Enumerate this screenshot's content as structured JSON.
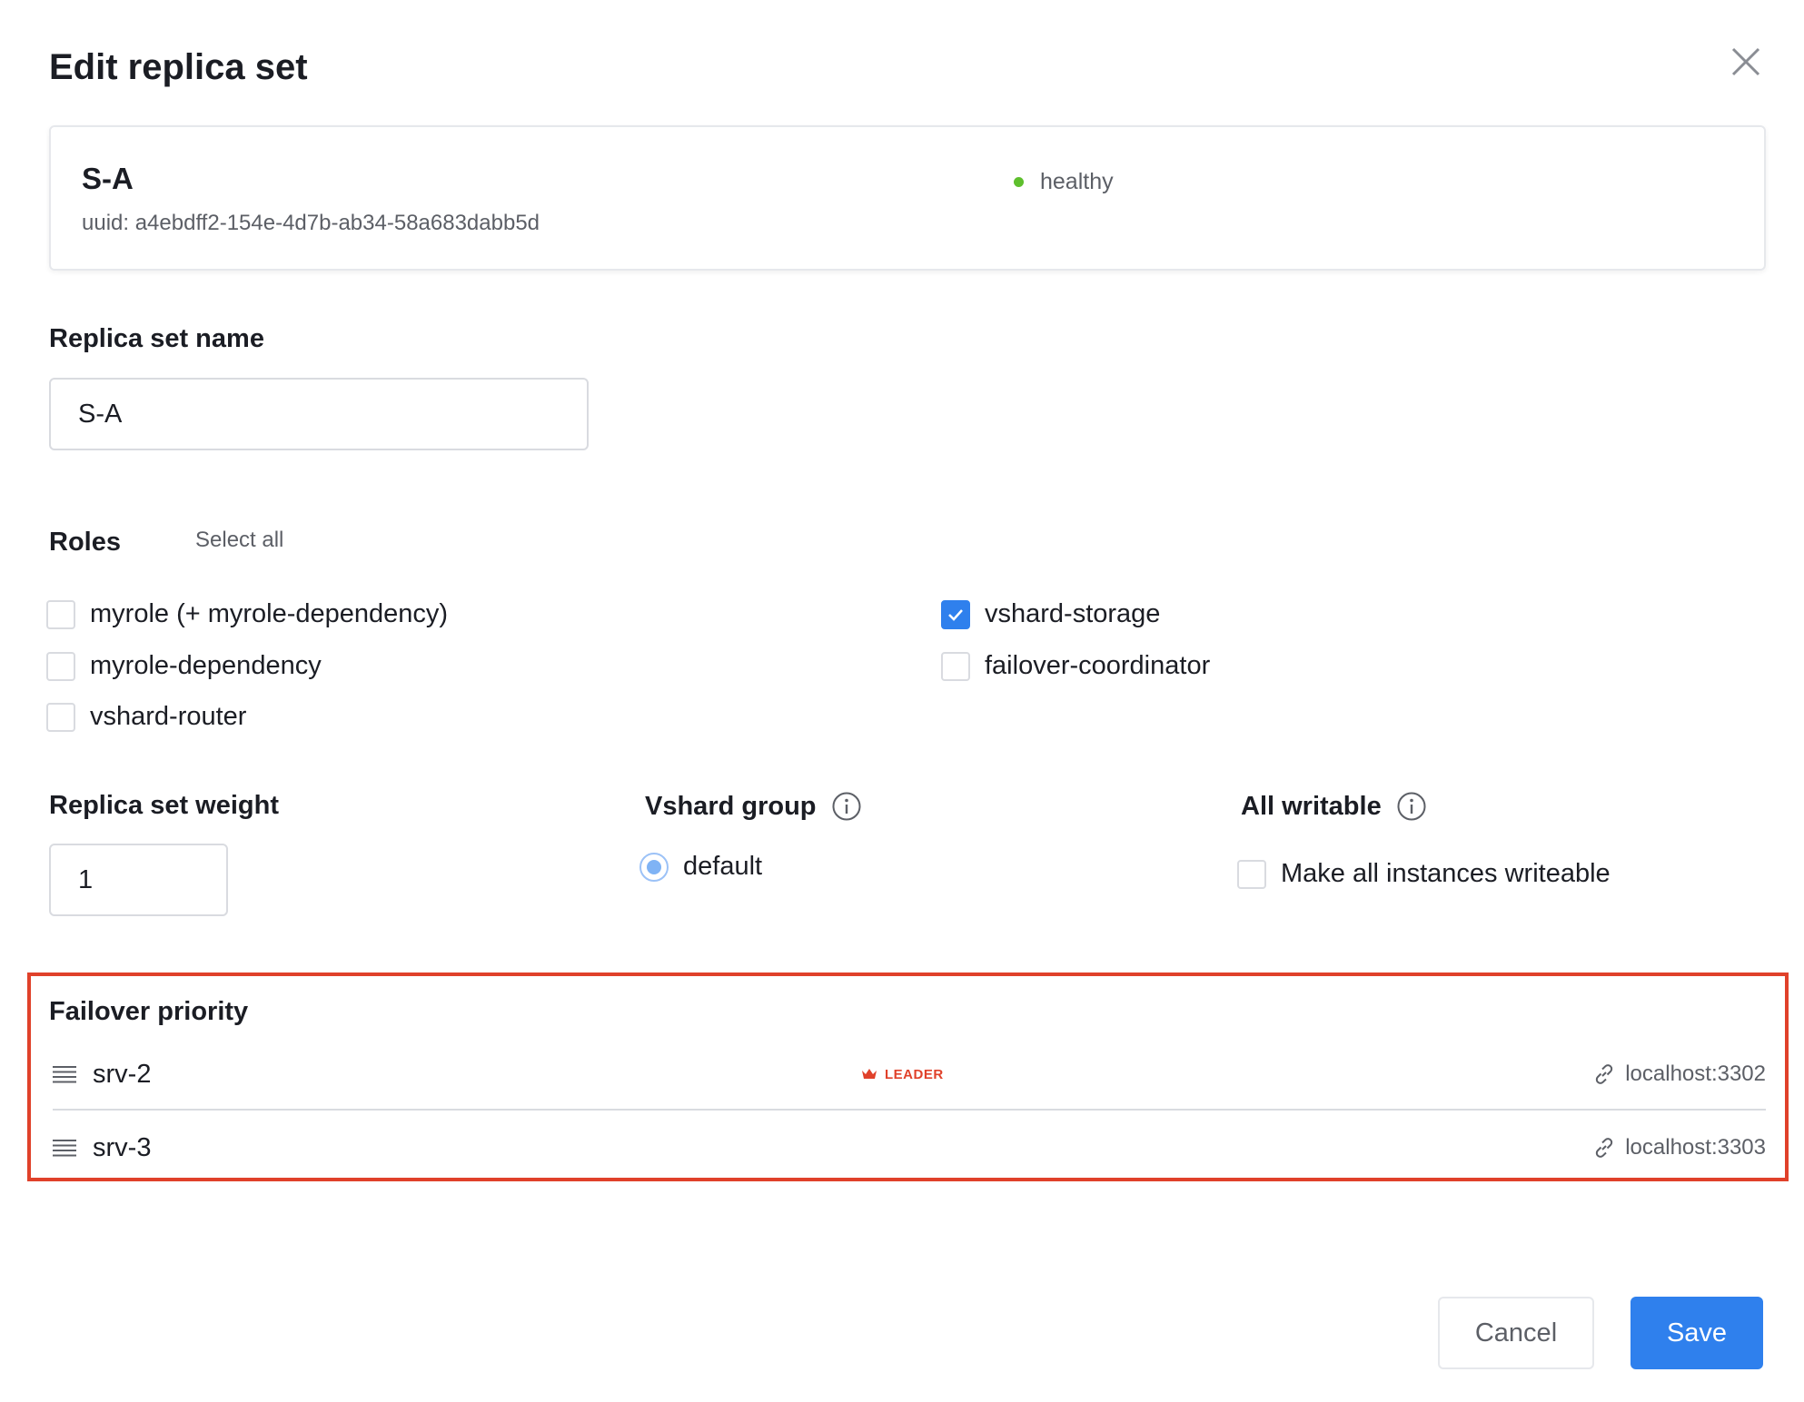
{
  "dialog": {
    "title": "Edit replica set"
  },
  "replicaset": {
    "name": "S-A",
    "uuid": "uuid: a4ebdff2-154e-4d7b-ab34-58a683dabb5d",
    "status": "healthy"
  },
  "name_field": {
    "label": "Replica set name",
    "value": "S-A"
  },
  "roles": {
    "label": "Roles",
    "select_all": "Select all",
    "items": [
      {
        "label": "myrole (+ myrole-dependency)",
        "checked": false
      },
      {
        "label": "myrole-dependency",
        "checked": false
      },
      {
        "label": "vshard-router",
        "checked": false
      },
      {
        "label": "vshard-storage",
        "checked": true
      },
      {
        "label": "failover-coordinator",
        "checked": false
      }
    ]
  },
  "weight": {
    "label": "Replica set weight",
    "value": "1"
  },
  "vshard_group": {
    "label": "Vshard group",
    "option": "default",
    "selected": true
  },
  "all_writable": {
    "label": "All writable",
    "option": "Make all instances writeable",
    "checked": false
  },
  "failover": {
    "label": "Failover priority",
    "servers": [
      {
        "name": "srv-2",
        "badge": "LEADER",
        "uri": "localhost:3302"
      },
      {
        "name": "srv-3",
        "badge": "",
        "uri": "localhost:3303"
      }
    ]
  },
  "buttons": {
    "cancel": "Cancel",
    "save": "Save"
  },
  "colors": {
    "accent": "#2f80ed",
    "healthy": "#5ebf2d",
    "leader": "#e0412a",
    "highlight_border": "#e0412a"
  },
  "icons": {
    "close": "close-icon",
    "info": "info-icon",
    "drag": "drag-handle-icon",
    "link": "link-icon",
    "crown": "crown-icon",
    "check": "check-icon"
  }
}
